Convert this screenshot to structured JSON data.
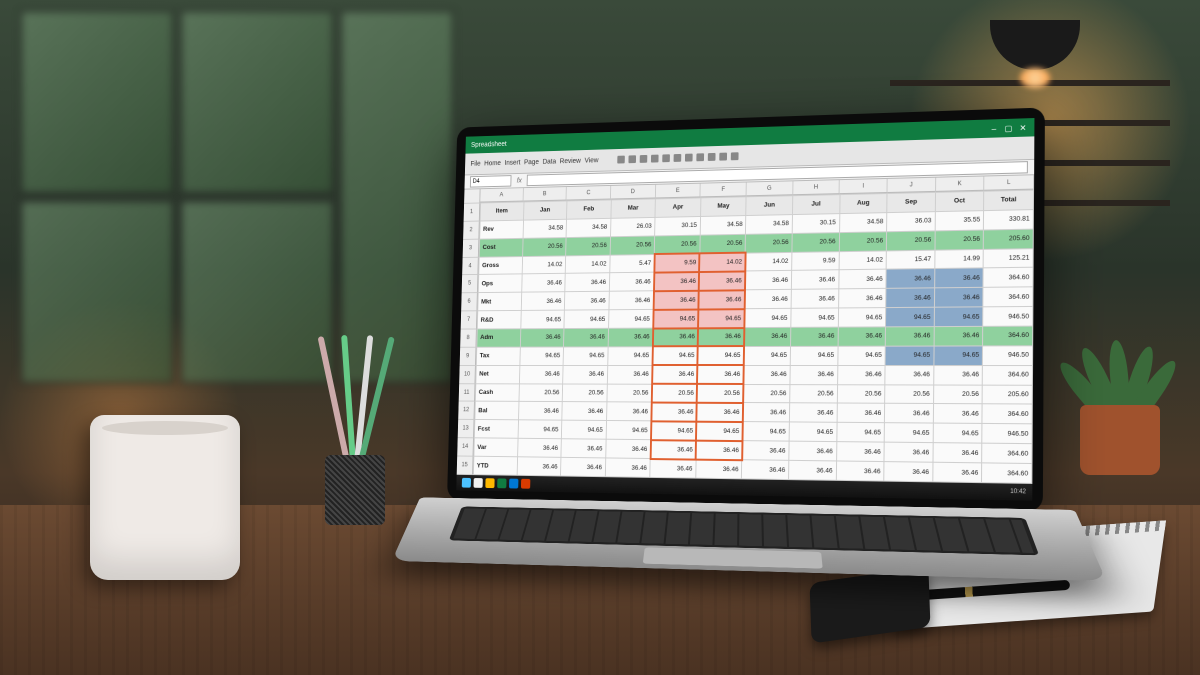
{
  "titlebar": {
    "app_name": "Spreadsheet"
  },
  "window_controls": {
    "min": "–",
    "max": "▢",
    "close": "✕"
  },
  "toolbar": {
    "items": [
      "File",
      "Home",
      "Insert",
      "Page",
      "Data",
      "Review",
      "View"
    ],
    "icons": [
      "save-icon",
      "undo-icon",
      "redo-icon",
      "bold-icon",
      "italic-icon",
      "fill-icon",
      "border-icon",
      "align-icon",
      "sort-icon",
      "filter-icon",
      "chart-icon"
    ]
  },
  "formula": {
    "namebox": "D4",
    "fx": "fx"
  },
  "columns": [
    "A",
    "B",
    "C",
    "D",
    "E",
    "F",
    "G",
    "H",
    "I",
    "J",
    "K",
    "L"
  ],
  "row_numbers": [
    "1",
    "2",
    "3",
    "4",
    "5",
    "6",
    "7",
    "8",
    "9",
    "10",
    "11",
    "12",
    "13",
    "14",
    "15"
  ],
  "headers": [
    "Item",
    "Jan",
    "Feb",
    "Mar",
    "Apr",
    "May",
    "Jun",
    "Jul",
    "Aug",
    "Sep",
    "Oct",
    "Total"
  ],
  "rows": [
    [
      "Rev",
      "34.58",
      "34.58",
      "26.03",
      "30.15",
      "34.58",
      "34.58",
      "30.15",
      "34.58",
      "36.03",
      "35.55",
      "330.81"
    ],
    [
      "Cost",
      "20.56",
      "20.56",
      "20.56",
      "20.56",
      "20.56",
      "20.56",
      "20.56",
      "20.56",
      "20.56",
      "20.56",
      "205.60"
    ],
    [
      "Gross",
      "14.02",
      "14.02",
      "5.47",
      "9.59",
      "14.02",
      "14.02",
      "9.59",
      "14.02",
      "15.47",
      "14.99",
      "125.21"
    ],
    [
      "Ops",
      "36.46",
      "36.46",
      "36.46",
      "36.46",
      "36.46",
      "36.46",
      "36.46",
      "36.46",
      "36.46",
      "36.46",
      "364.60"
    ],
    [
      "Mkt",
      "36.46",
      "36.46",
      "36.46",
      "36.46",
      "36.46",
      "36.46",
      "36.46",
      "36.46",
      "36.46",
      "36.46",
      "364.60"
    ],
    [
      "R&D",
      "94.65",
      "94.65",
      "94.65",
      "94.65",
      "94.65",
      "94.65",
      "94.65",
      "94.65",
      "94.65",
      "94.65",
      "946.50"
    ],
    [
      "Adm",
      "36.46",
      "36.46",
      "36.46",
      "36.46",
      "36.46",
      "36.46",
      "36.46",
      "36.46",
      "36.46",
      "36.46",
      "364.60"
    ],
    [
      "Tax",
      "94.65",
      "94.65",
      "94.65",
      "94.65",
      "94.65",
      "94.65",
      "94.65",
      "94.65",
      "94.65",
      "94.65",
      "946.50"
    ],
    [
      "Net",
      "36.46",
      "36.46",
      "36.46",
      "36.46",
      "36.46",
      "36.46",
      "36.46",
      "36.46",
      "36.46",
      "36.46",
      "364.60"
    ],
    [
      "Cash",
      "20.56",
      "20.56",
      "20.56",
      "20.56",
      "20.56",
      "20.56",
      "20.56",
      "20.56",
      "20.56",
      "20.56",
      "205.60"
    ],
    [
      "Bal",
      "36.46",
      "36.46",
      "36.46",
      "36.46",
      "36.46",
      "36.46",
      "36.46",
      "36.46",
      "36.46",
      "36.46",
      "364.60"
    ],
    [
      "Fcst",
      "94.65",
      "94.65",
      "94.65",
      "94.65",
      "94.65",
      "94.65",
      "94.65",
      "94.65",
      "94.65",
      "94.65",
      "946.50"
    ],
    [
      "Var",
      "36.46",
      "36.46",
      "36.46",
      "36.46",
      "36.46",
      "36.46",
      "36.46",
      "36.46",
      "36.46",
      "36.46",
      "364.60"
    ],
    [
      "YTD",
      "36.46",
      "36.46",
      "36.46",
      "36.46",
      "36.46",
      "36.46",
      "36.46",
      "36.46",
      "36.46",
      "36.46",
      "364.60"
    ]
  ],
  "highlight": {
    "green_rows": [
      2,
      7
    ],
    "pink_block": {
      "r0": 3,
      "r1": 6,
      "c0": 4,
      "c1": 5
    },
    "blue_block": {
      "r0": 4,
      "r1": 8,
      "c0": 9,
      "c1": 10
    },
    "selection": {
      "r0": 3,
      "r1": 13,
      "c0": 4,
      "c1": 5
    }
  },
  "taskbar": {
    "clock": "10:42"
  }
}
